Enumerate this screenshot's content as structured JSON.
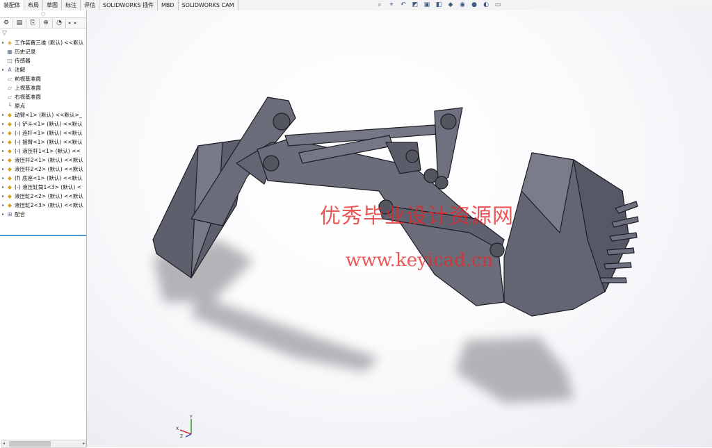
{
  "tabs": [
    {
      "label": "装配体",
      "active": true
    },
    {
      "label": "布局",
      "active": false
    },
    {
      "label": "草图",
      "active": false
    },
    {
      "label": "标注",
      "active": false
    },
    {
      "label": "评估",
      "active": false
    },
    {
      "label": "SOLIDWORKS 插件",
      "active": false
    },
    {
      "label": "MBD",
      "active": false
    },
    {
      "label": "SOLIDWORKS CAM",
      "active": false
    }
  ],
  "tree": {
    "root": "工作装置三维 (默认) <<默认",
    "items": [
      {
        "label": "历史记录",
        "icon": "history-icon"
      },
      {
        "label": "传感器",
        "icon": "sensor-icon"
      },
      {
        "label": "注解",
        "icon": "annotation-icon"
      },
      {
        "label": "前视基准面",
        "icon": "plane-icon"
      },
      {
        "label": "上视基准面",
        "icon": "plane-icon"
      },
      {
        "label": "右视基准面",
        "icon": "plane-icon"
      },
      {
        "label": "原点",
        "icon": "origin-icon"
      },
      {
        "label": "动臂<1> (默认) <<默认>_",
        "icon": "part-icon"
      },
      {
        "label": "(-) 铲斗<1> (默认) <<默认",
        "icon": "part-icon"
      },
      {
        "label": "(-) 连杆<1> (默认) <<默认",
        "icon": "part-icon"
      },
      {
        "label": "(-) 摇臂<1> (默认) <<默认",
        "icon": "part-icon"
      },
      {
        "label": "(-) 液压杆1<1> (默认) <<",
        "icon": "part-icon"
      },
      {
        "label": "液压杆2<1> (默认) <<默认",
        "icon": "part-icon"
      },
      {
        "label": "液压杆2<2> (默认) <<默认",
        "icon": "part-icon"
      },
      {
        "label": "(f) 底座<1> (默认) <<默认",
        "icon": "part-icon"
      },
      {
        "label": "(-) 液压缸筒1<3> (默认) <",
        "icon": "part-icon"
      },
      {
        "label": "液压缸2<2> (默认) <<默认",
        "icon": "part-icon"
      },
      {
        "label": "液压缸2<3> (默认) <<默认",
        "icon": "part-icon"
      },
      {
        "label": "配合",
        "icon": "mates-icon"
      }
    ]
  },
  "watermark": {
    "line1": "优秀毕业设计资源网",
    "line2": "www.keyicad.cn"
  },
  "triad": {
    "y": "Y",
    "x": "X",
    "z": "Z"
  },
  "colors": {
    "model": "#686a78",
    "watermark": "#e42828",
    "accent": "#4a9ad8"
  }
}
